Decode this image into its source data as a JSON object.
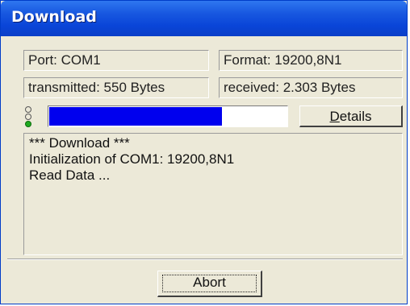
{
  "window": {
    "title": "Download"
  },
  "info": {
    "port": "Port: COM1",
    "format": "Format: 19200,8N1",
    "transmitted": "transmitted: 550 Bytes",
    "received": "received: 2.303 Bytes"
  },
  "status": {
    "led_states": [
      "off",
      "off",
      "on"
    ],
    "progress_percent": 73
  },
  "buttons": {
    "details": "Details",
    "abort": "Abort"
  },
  "log": {
    "lines": [
      "*** Download ***",
      "Initialization of COM1: 19200,8N1",
      "Read Data ..."
    ]
  },
  "colors": {
    "titlebar": "#0a45d8",
    "progress_fill": "#0000ee",
    "led_on": "#1faa1f",
    "background": "#ece9d8"
  }
}
